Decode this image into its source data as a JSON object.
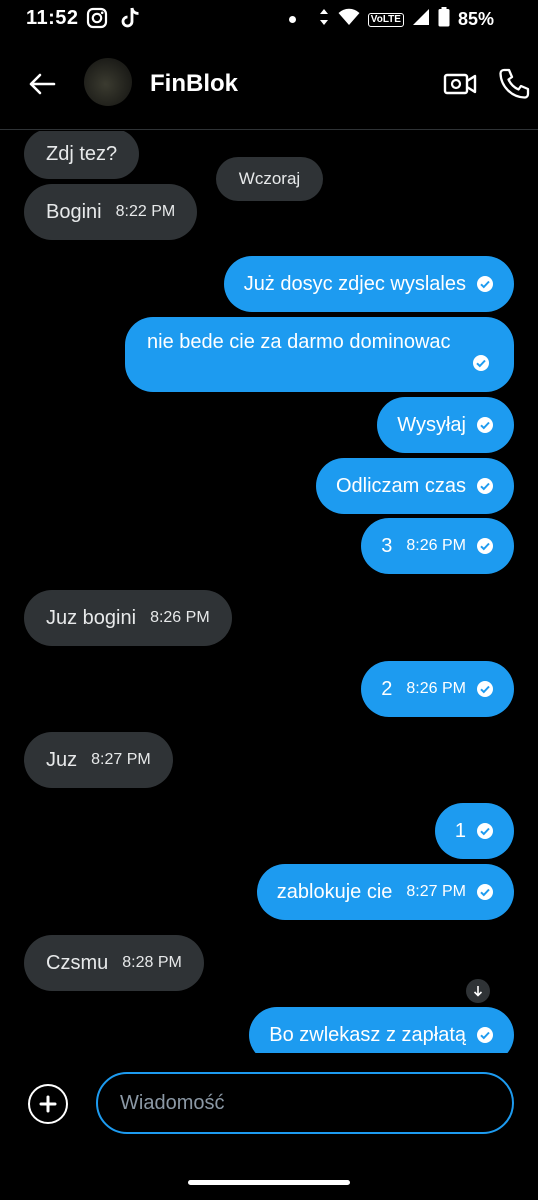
{
  "status_bar": {
    "time": "11:52",
    "battery": "85%",
    "network_badge": "VoLTE",
    "icons": [
      "instagram-icon",
      "tiktok-icon",
      "dot-icon",
      "data-arrows-icon",
      "wifi-icon",
      "signal-icon",
      "battery-icon"
    ]
  },
  "header": {
    "contact_name": "FinBlok",
    "icons": [
      "back-arrow-icon",
      "video-call-icon",
      "phone-icon"
    ]
  },
  "date_separator": "Wczoraj",
  "messages": [
    {
      "dir": "in",
      "text": "Zdj tez?",
      "time": ""
    },
    {
      "dir": "in",
      "text": "Bogini",
      "time": "8:22 PM"
    },
    {
      "dir": "out",
      "text": "Już dosyc zdjec wyslales",
      "time": ""
    },
    {
      "dir": "out",
      "text": "nie bede cie za darmo dominowac",
      "time": ""
    },
    {
      "dir": "out",
      "text": "Wysyłaj",
      "time": ""
    },
    {
      "dir": "out",
      "text": "Odliczam czas",
      "time": ""
    },
    {
      "dir": "out",
      "text": "3",
      "time": "8:26 PM"
    },
    {
      "dir": "in",
      "text": "Juz bogini",
      "time": "8:26 PM"
    },
    {
      "dir": "out",
      "text": "2",
      "time": "8:26 PM"
    },
    {
      "dir": "in",
      "text": "Juz",
      "time": "8:27 PM"
    },
    {
      "dir": "out",
      "text": "1",
      "time": ""
    },
    {
      "dir": "out",
      "text": "zablokuje cie",
      "time": "8:27 PM"
    },
    {
      "dir": "in",
      "text": "Czsmu",
      "time": "8:28 PM"
    },
    {
      "dir": "out",
      "text": "Bo zwlekasz z zapłatą",
      "time": ""
    }
  ],
  "composer": {
    "placeholder": "Wiadomość",
    "value": ""
  },
  "colors": {
    "background": "#000000",
    "outgoing_bubble": "#1d9bf0",
    "incoming_bubble": "#2f3336",
    "accent": "#1d9bf0"
  }
}
